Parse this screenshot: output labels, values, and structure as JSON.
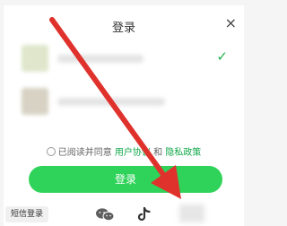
{
  "dialog": {
    "title": "登录",
    "close_label": "×"
  },
  "accounts": [
    {
      "selected": true,
      "check": "✓"
    },
    {
      "selected": false,
      "check": ""
    }
  ],
  "agreement": {
    "prefix": "已阅读并同意",
    "user_agreement": "用户协议",
    "and": "和",
    "privacy_policy": "隐私政策"
  },
  "login_button": "登录",
  "bottom": {
    "sms_login": "短信登录",
    "icons": [
      "wechat-icon",
      "tiktok-icon",
      "more-icon"
    ]
  },
  "colors": {
    "accent": "#2fd35a",
    "link": "#12a84a",
    "annotation_arrow": "#e0322c"
  }
}
